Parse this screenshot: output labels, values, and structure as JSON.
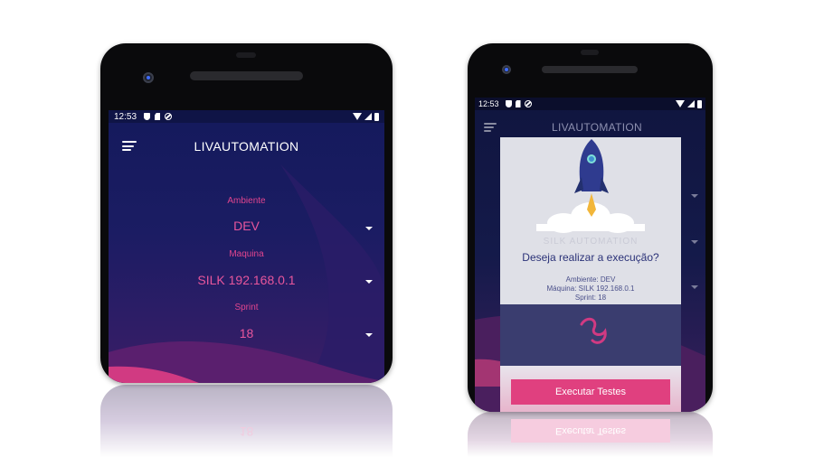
{
  "left_phone": {
    "status": {
      "time": "12:53"
    },
    "app_title": "LIVAUTOMATION",
    "fields": [
      {
        "label": "Ambiente",
        "value": "DEV"
      },
      {
        "label": "Maquina",
        "value": "SILK 192.168.0.1"
      },
      {
        "label": "Sprint",
        "value": "18"
      }
    ],
    "reflection_value": "18"
  },
  "right_phone": {
    "status": {
      "time": "12:53"
    },
    "app_title": "LIVAUTOMATION",
    "dialog": {
      "faded_text": "SILK AUTOMATION",
      "question": "Deseja realizar a execução?",
      "details": [
        "Ambiente: DEV",
        "Máquina: SILK 192.168.0.1",
        "Sprint: 18"
      ],
      "execute_label": "Executar Testes"
    }
  },
  "colors": {
    "accent": "#e0407f",
    "app_bg_top": "#141a5c",
    "app_bg_bottom": "#3b1d66",
    "label_pink": "#e2458e"
  },
  "icons": [
    "menu-icon",
    "dropdown-caret-icon",
    "rocket-icon",
    "cloud-icon",
    "loading-logo-icon",
    "shield-icon",
    "sd-card-icon",
    "dnd-icon",
    "wifi-icon",
    "signal-icon",
    "battery-icon",
    "camera-icon"
  ]
}
